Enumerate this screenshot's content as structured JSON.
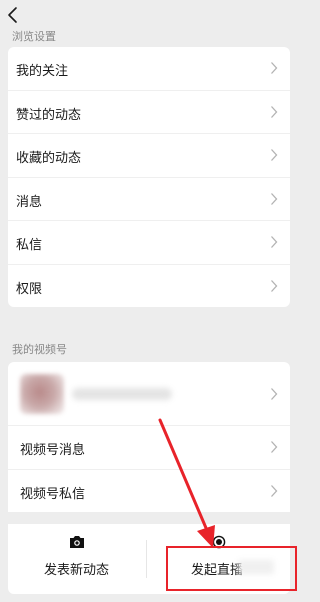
{
  "header": {
    "section_title": "浏览设置"
  },
  "browse_settings": {
    "items": [
      {
        "label": "我的关注"
      },
      {
        "label": "赞过的动态"
      },
      {
        "label": "收藏的动态"
      },
      {
        "label": "消息"
      },
      {
        "label": "私信"
      },
      {
        "label": "权限"
      }
    ]
  },
  "channels": {
    "section_title": "我的视频号",
    "items": [
      {
        "label": "视频号消息"
      },
      {
        "label": "视频号私信"
      }
    ]
  },
  "actions": {
    "post_label": "发表新动态",
    "live_label": "发起直播"
  },
  "annotation": {
    "color": "#e8232a"
  }
}
